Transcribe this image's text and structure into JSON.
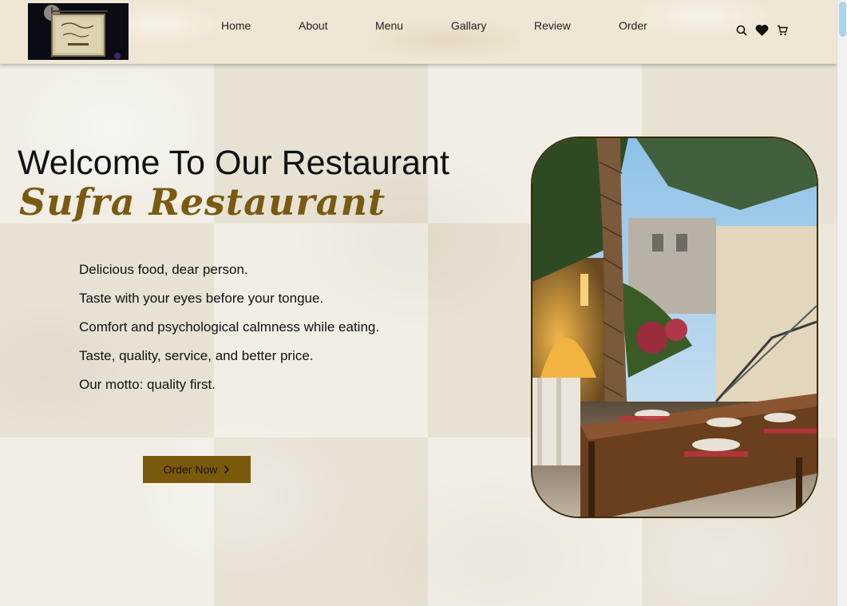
{
  "header": {
    "logo_alt": "Sufra Restaurant",
    "nav": [
      {
        "label": "Home"
      },
      {
        "label": "About"
      },
      {
        "label": "Menu"
      },
      {
        "label": "Gallary"
      },
      {
        "label": "Review"
      },
      {
        "label": "Order"
      }
    ],
    "icons": [
      "search-icon",
      "heart-icon",
      "cart-icon"
    ]
  },
  "hero": {
    "title": "Welcome To Our Restaurant",
    "subtitle": "Sufra Restaurant",
    "taglines": [
      "Delicious food, dear person.",
      "Taste with your eyes before your tongue.",
      "Comfort and psychological calmness while eating.",
      "Taste, quality, service, and better price.",
      "Our motto: quality first."
    ],
    "order_button": "Order Now",
    "photo": "restaurant-courtyard-photo"
  },
  "colors": {
    "accent": "#7a5a0a",
    "subtitle": "#7a5a12",
    "photo_border": "#3d2b05"
  }
}
